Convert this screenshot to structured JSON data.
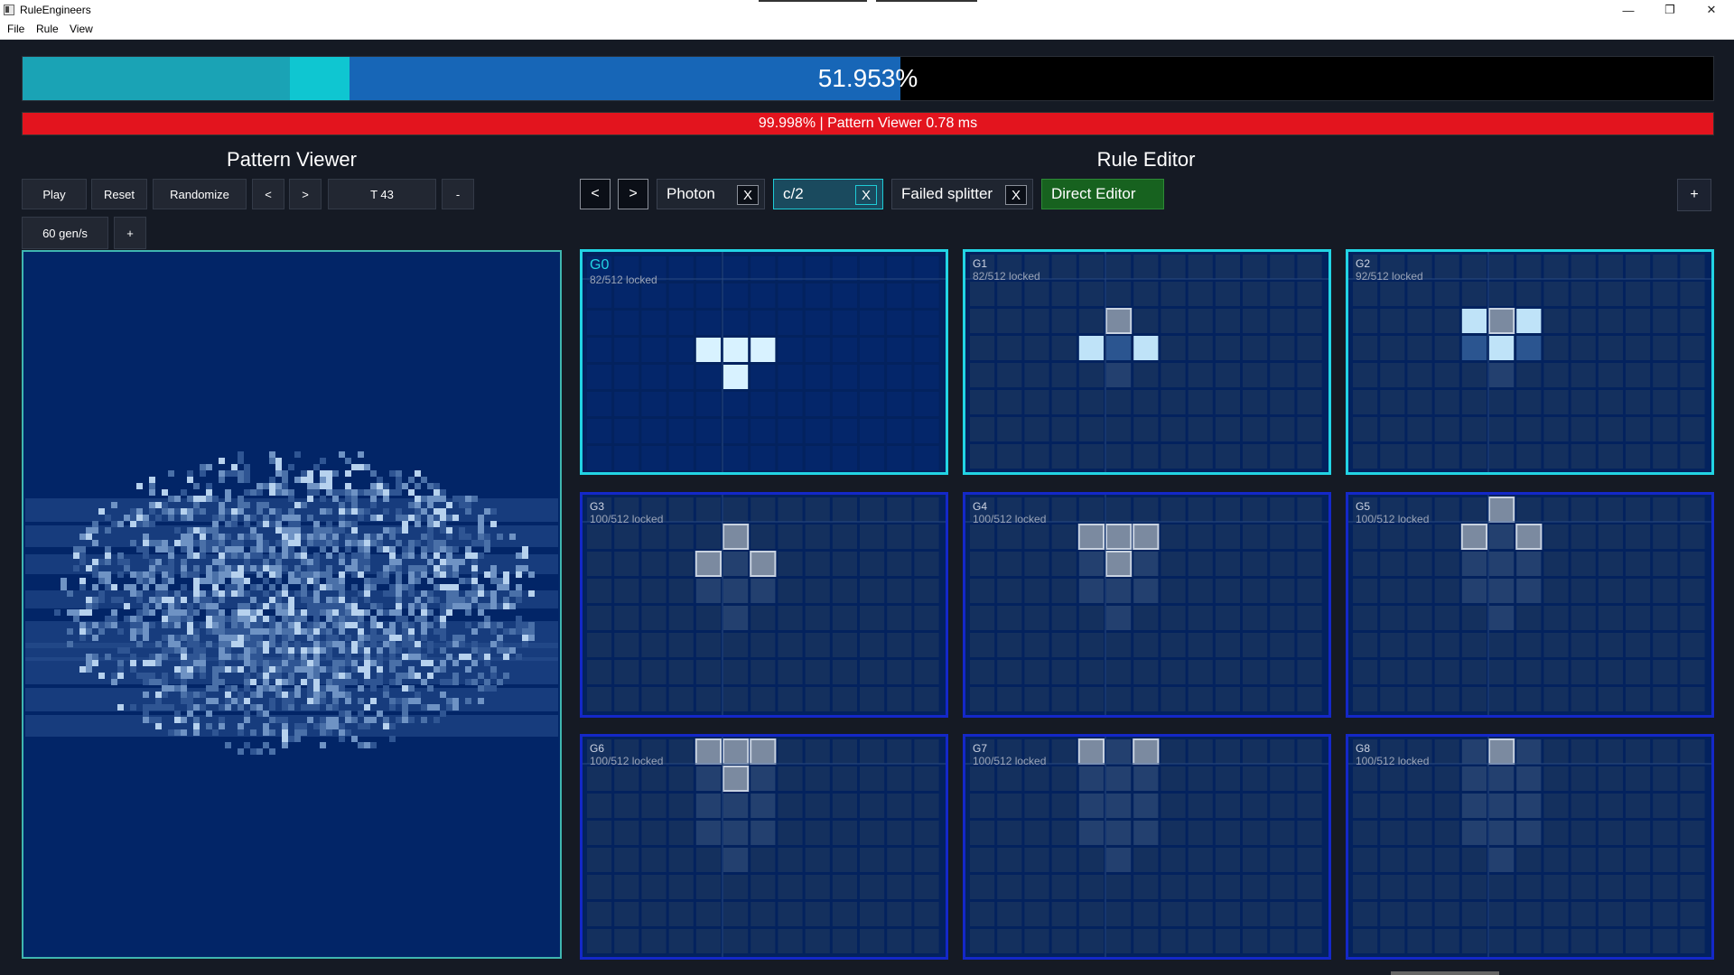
{
  "window": {
    "title": "RuleEngineers",
    "minimize": "—",
    "maximize": "❐",
    "close": "✕"
  },
  "menu": {
    "items": [
      "File",
      "Rule",
      "View"
    ]
  },
  "progress": {
    "main_text": "51.953%",
    "main_value": 0.51953,
    "secondary_text": "99.998% | Pattern Viewer 0.78 ms",
    "colors": {
      "teal": "#1aa3b5",
      "cyan": "#0fc6d1",
      "blue": "#1766b7",
      "red": "#e3141e"
    }
  },
  "pattern_viewer": {
    "title": "Pattern Viewer",
    "buttons": {
      "play": "Play",
      "reset": "Reset",
      "randomize": "Randomize",
      "prev": "<",
      "next": ">",
      "time": "T 43",
      "minus": "-",
      "speed": "60 gen/s",
      "plus": "+"
    }
  },
  "rule_editor": {
    "title": "Rule Editor",
    "nav": {
      "prev": "<",
      "next": ">",
      "add": "+"
    },
    "tabs": [
      {
        "label": "Photon",
        "close": "X",
        "active": false
      },
      {
        "label": "c/2",
        "close": "X",
        "active": true
      },
      {
        "label": "Failed splitter",
        "close": "X",
        "active": false
      }
    ],
    "direct_editor": "Direct Editor",
    "cards": [
      {
        "name": "G0",
        "locked": "82/512 locked"
      },
      {
        "name": "G1",
        "locked": "82/512 locked"
      },
      {
        "name": "G2",
        "locked": "92/512 locked"
      },
      {
        "name": "G3",
        "locked": "100/512 locked"
      },
      {
        "name": "G4",
        "locked": "100/512 locked"
      },
      {
        "name": "G5",
        "locked": "100/512 locked"
      },
      {
        "name": "G6",
        "locked": "100/512 locked"
      },
      {
        "name": "G7",
        "locked": "100/512 locked"
      },
      {
        "name": "G8",
        "locked": "100/512 locked"
      }
    ]
  }
}
